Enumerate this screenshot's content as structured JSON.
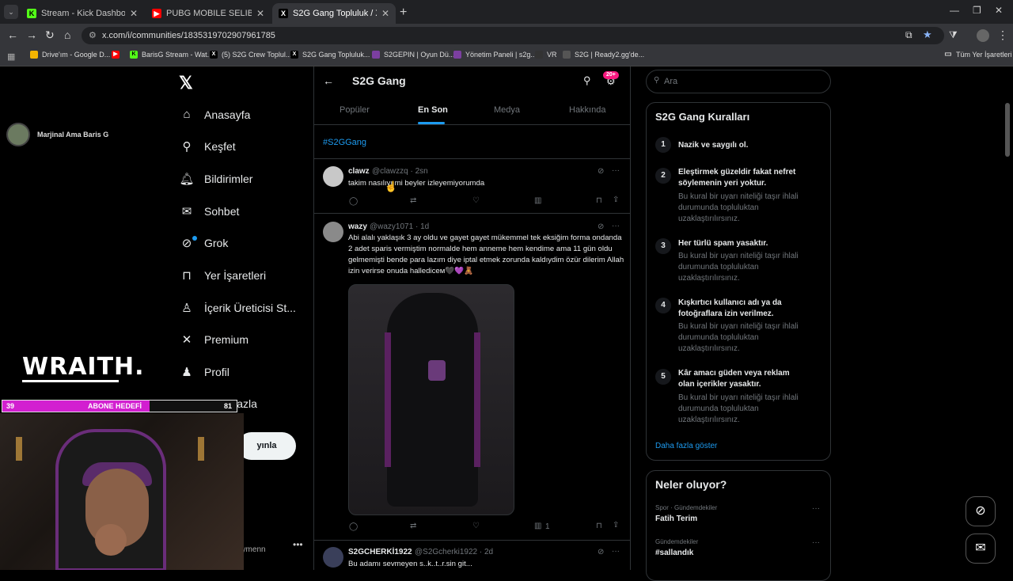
{
  "browser": {
    "tabs": [
      {
        "title": "Stream - Kick Dashboard",
        "fav": "K",
        "color": "#53fc18"
      },
      {
        "title": "PUBG MOBILE SELIBON LEAGUE",
        "fav": "▶",
        "color": "#ff0000"
      },
      {
        "title": "S2G Gang Topluluk / X",
        "fav": "X",
        "color": "#000000"
      }
    ],
    "url": "x.com/i/communities/1835319702907961785",
    "bookmarks": [
      {
        "label": "Drive'ım - Google D...",
        "color": "#f4b400"
      },
      {
        "label": "",
        "color": "#ff0000"
      },
      {
        "label": "BarisG Stream - Wat...",
        "color": "#53fc18"
      },
      {
        "label": "(5) S2G Crew Toplul...",
        "color": "#000000"
      },
      {
        "label": "S2G Gang Topluluk...",
        "color": "#000000"
      },
      {
        "label": "S2GEPIN | Oyun Dü...",
        "color": "#7b3fa0"
      },
      {
        "label": "Yönetim Paneli | s2g...",
        "color": "#7b3fa0"
      },
      {
        "label": "VR",
        "color": "#333333"
      },
      {
        "label": "S2G | Ready2.gg'de...",
        "color": "#555555"
      }
    ],
    "all_bookmarks": "Tüm Yer İşaretleri"
  },
  "sidebar": {
    "items": [
      {
        "label": "Anasayfa",
        "icon": "home-icon"
      },
      {
        "label": "Keşfet",
        "icon": "search-icon"
      },
      {
        "label": "Bildirimler",
        "icon": "bell-icon"
      },
      {
        "label": "Sohbet",
        "icon": "mail-icon"
      },
      {
        "label": "Grok",
        "icon": "grok-icon"
      },
      {
        "label": "Yer İşaretleri",
        "icon": "bookmark-icon"
      },
      {
        "label": "İçerik Üreticisi St...",
        "icon": "creator-icon"
      },
      {
        "label": "Premium",
        "icon": "x-icon"
      },
      {
        "label": "Profil",
        "icon": "person-icon"
      },
      {
        "label": "Daha fazla",
        "icon": "more-icon"
      }
    ],
    "post_button": "yınla",
    "account_fragment": "eymenn"
  },
  "overlay": {
    "profile_name": "Marjinal Ama Baris G",
    "brand": "WRAITH.",
    "sub_goal_current": "39",
    "sub_goal_label": "ABONE HEDEFİ",
    "sub_goal_target": "81",
    "sub_goal_progress": 0.63
  },
  "community": {
    "title": "S2G Gang",
    "notification_badge": "20+",
    "tabs": [
      "Popüler",
      "En Son",
      "Medya",
      "Hakkında"
    ],
    "active_tab": "En Son",
    "hashtag": "#S2GGang"
  },
  "tweets": [
    {
      "name": "clawz",
      "handle": "@clawzzq · 2sn",
      "text": "takim nasılıyı mi beyler izleyemiyorumda",
      "views": ""
    },
    {
      "name": "wazy",
      "handle": "@wazy1071 · 1d",
      "text": "Abi alalı yaklaşık 3 ay oldu ve gayet gayet mükemmel tek eksiğim forma ondanda 2 adet sparis vermiştim normalde hem anneme hem kendime ama 11 gün oldu gelmemişti bende para lazım diye iptal etmek zorunda kaldıydim özür dilerim Allah izin verirse onuda hallediceм🖤💜🧸",
      "views": "1"
    },
    {
      "name": "S2GCHERKİ1922",
      "handle": "@S2Gcherki1922 · 2d",
      "text": "Bu adamı sevmeyen s..k..t..r.sin git...",
      "views": ""
    }
  ],
  "right": {
    "search_placeholder": "Ara",
    "rules_title": "S2G Gang Kuralları",
    "rules": [
      {
        "num": "1",
        "title": "Nazik ve saygılı ol.",
        "desc": ""
      },
      {
        "num": "2",
        "title": "Eleştirmek güzeldir fakat nefret söylemenin yeri yoktur.",
        "desc": "Bu kural bir uyarı niteliği taşır ihlali durumunda topluluktan uzaklaştırılırsınız."
      },
      {
        "num": "3",
        "title": "Her türlü spam yasaktır.",
        "desc": "Bu kural bir uyarı niteliği taşır ihlali durumunda topluluktan uzaklaştırılırsınız."
      },
      {
        "num": "4",
        "title": "Kışkırtıcı kullanıcı adı ya da fotoğraflara izin verilmez.",
        "desc": "Bu kural bir uyarı niteliği taşır ihlali durumunda topluluktan uzaklaştırılırsınız."
      },
      {
        "num": "5",
        "title": "Kâr amacı güden veya reklam olan içerikler yasaktır.",
        "desc": "Bu kural bir uyarı niteliği taşır ihlali durumunda topluluktan uzaklaştırılırsınız."
      }
    ],
    "show_more": "Daha fazla göster",
    "trends_title": "Neler oluyor?",
    "trends": [
      {
        "category": "Spor · Gündemdekiler",
        "name": "Fatih Terim"
      },
      {
        "category": "Gündemdekiler",
        "name": "#sallandık"
      }
    ]
  }
}
